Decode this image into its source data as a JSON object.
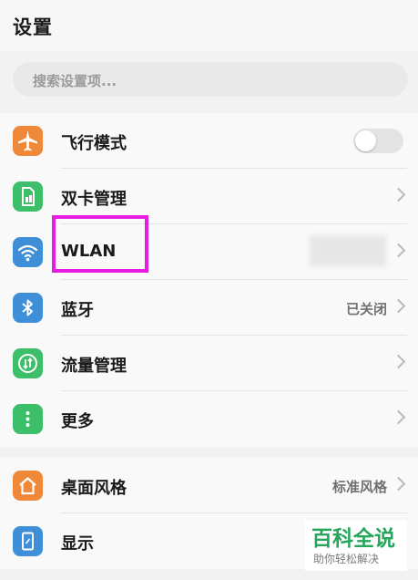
{
  "header": {
    "title": "设置"
  },
  "search": {
    "placeholder": "搜索设置项..."
  },
  "section1": {
    "items": [
      {
        "label": "飞行模式",
        "icon": "airplane-icon",
        "toggle_on": false
      },
      {
        "label": "双卡管理",
        "icon": "sim-card-icon"
      },
      {
        "label": "WLAN",
        "icon": "wifi-icon"
      },
      {
        "label": "蓝牙",
        "icon": "bluetooth-icon",
        "value": "已关闭"
      },
      {
        "label": "流量管理",
        "icon": "data-usage-icon"
      },
      {
        "label": "更多",
        "icon": "more-dots-icon"
      }
    ]
  },
  "section2": {
    "items": [
      {
        "label": "桌面风格",
        "icon": "home-icon",
        "value": "标准风格"
      },
      {
        "label": "显示",
        "icon": "display-icon"
      }
    ]
  },
  "watermark": {
    "title": "百科全说",
    "subtitle": "助你轻松解决"
  },
  "colors": {
    "orange": "#f0883a",
    "green": "#3dbf6a",
    "blue": "#3f8fd8",
    "highlight": "#e81be0"
  }
}
